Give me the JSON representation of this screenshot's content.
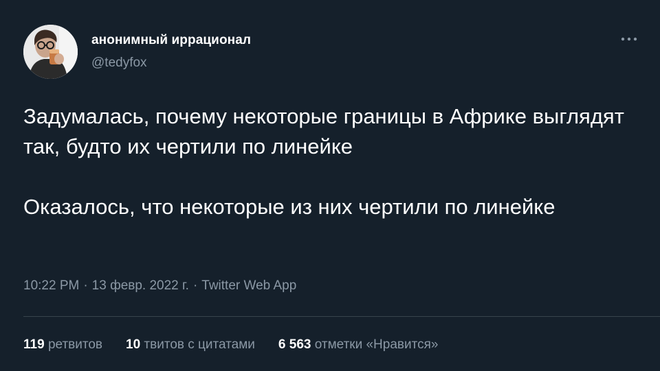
{
  "author": {
    "display_name": "анонимный иррационал",
    "handle": "@tedyfox",
    "avatar_icon": "user-avatar"
  },
  "more_icon": "more-horizontal-icon",
  "tweet": {
    "paragraphs": [
      "Задумалась, почему некоторые границы в Африке выглядят так, будто их чертили по линейке",
      "Оказалось, что некоторые из них чертили по линейке"
    ]
  },
  "meta": {
    "time": "10:22 PM",
    "separator": "·",
    "date": "13 февр. 2022 г.",
    "source": "Twitter Web App"
  },
  "stats": [
    {
      "count": "119",
      "label": "ретвитов"
    },
    {
      "count": "10",
      "label": "твитов с цитатами"
    },
    {
      "count": "6 563",
      "label": "отметки «Нравится»"
    }
  ],
  "colors": {
    "background": "#15202b",
    "text_primary": "#ffffff",
    "text_secondary": "#8b98a5",
    "divider": "#38444d"
  }
}
